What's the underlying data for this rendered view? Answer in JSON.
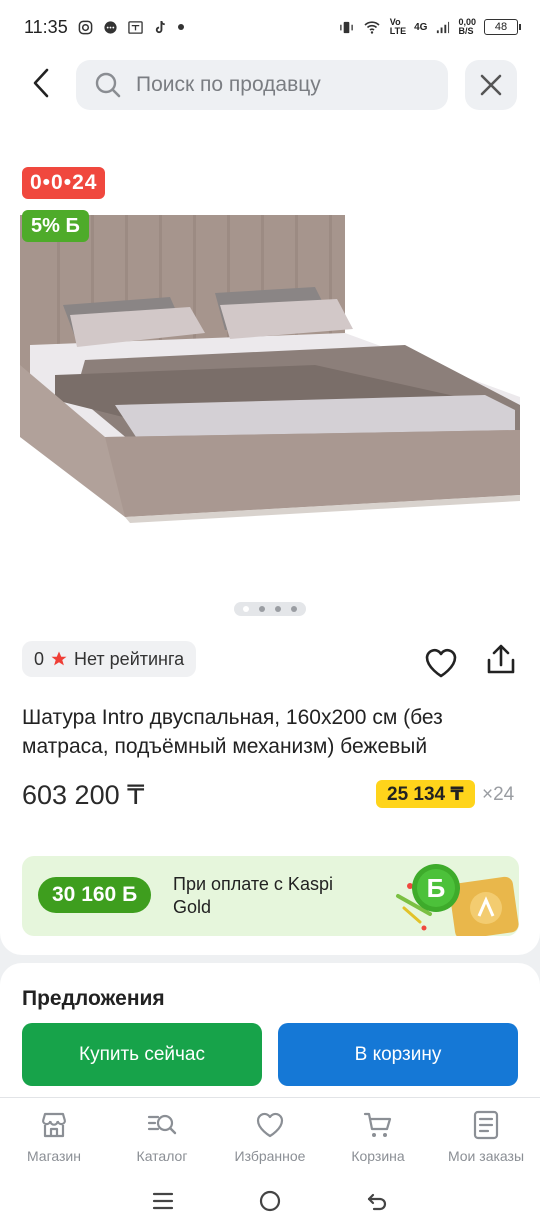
{
  "status_bar": {
    "time": "11:35",
    "network_labels": [
      "Vo",
      "LTE",
      "4G"
    ],
    "speed": "0,00",
    "speed_unit": "B/S",
    "battery": "48"
  },
  "header": {
    "search_placeholder": "Поиск по продавцу",
    "icons": [
      "back-arrow-icon",
      "search-icon",
      "close-icon"
    ]
  },
  "product": {
    "timer_badge": "0•0•24",
    "bonus_badge": "5% Б",
    "image_dots": {
      "count": 4,
      "active": 0
    },
    "rating_value": "0",
    "rating_text": "Нет рейтинга",
    "title": "Шатура Intro двуспальная, 160x200 см (без матраса, подъёмный механизм) бежевый",
    "price": "603 200 ₸",
    "installment_price": "25 134 ₸",
    "installment_term": "×24"
  },
  "kaspi_gold": {
    "bonus_amount": "30 160 Б",
    "text": "При оплате с Kaspi Gold"
  },
  "offers": {
    "title": "Предложения",
    "buy_now": "Купить сейчас",
    "add_to_cart": "В корзину"
  },
  "tabbar": {
    "items": [
      {
        "label": "Магазин",
        "icon": "store-icon"
      },
      {
        "label": "Каталог",
        "icon": "catalog-search-icon"
      },
      {
        "label": "Избранное",
        "icon": "heart-icon"
      },
      {
        "label": "Корзина",
        "icon": "cart-icon"
      },
      {
        "label": "Мои заказы",
        "icon": "orders-icon"
      }
    ]
  },
  "colors": {
    "timer_red": "#f0483e",
    "bonus_green": "#4eab2a",
    "installment_yellow": "#ffd41b",
    "buy_green": "#17a34a",
    "cart_blue": "#1578d6",
    "gold_banner_bg": "#e6f6dc"
  }
}
